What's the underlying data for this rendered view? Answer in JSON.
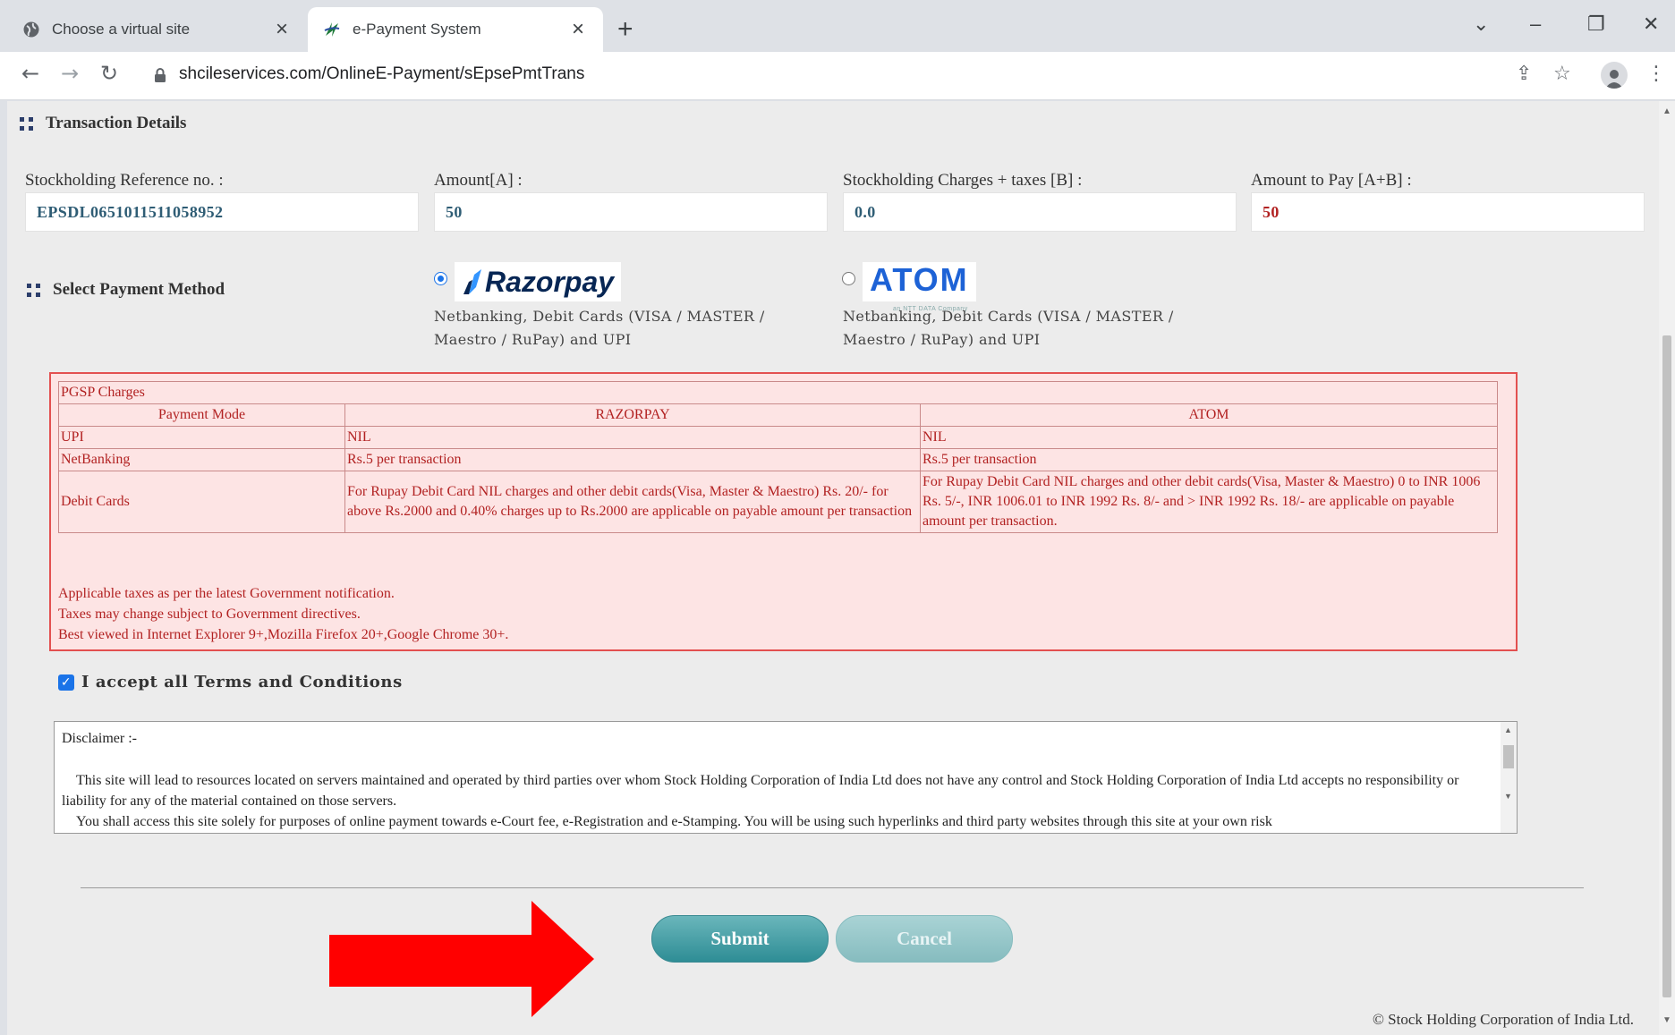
{
  "browser": {
    "tabs": [
      {
        "label": "Choose a virtual site",
        "active": false
      },
      {
        "label": "e-Payment System",
        "active": true
      }
    ],
    "url": "shcileservices.com/OnlineE-Payment/sEpsePmtTrans"
  },
  "transaction": {
    "title": "Transaction Details",
    "fields": [
      {
        "label": "Stockholding Reference no. :",
        "value": "EPSDL0651011511058952"
      },
      {
        "label": "Amount[A] :",
        "value": "50"
      },
      {
        "label": "Stockholding Charges + taxes [B] :",
        "value": "0.0"
      },
      {
        "label": "Amount to Pay [A+B] :",
        "value": "50"
      }
    ]
  },
  "payment": {
    "title": "Select Payment Method",
    "options": [
      {
        "logo": "Razorpay",
        "selected": true,
        "desc_line1": "Netbanking, Debit Cards (VISA / MASTER /",
        "desc_line2": "Maestro / RuPay) and UPI"
      },
      {
        "logo": "ATOM",
        "logo_tagline": "an NTT DATA Company",
        "selected": false,
        "desc_line1": "Netbanking, Debit Cards (VISA / MASTER /",
        "desc_line2": "Maestro / RuPay) and UPI"
      }
    ]
  },
  "pgsp": {
    "caption": "PGSP Charges",
    "headers": [
      "Payment Mode",
      "RAZORPAY",
      "ATOM"
    ],
    "rows": [
      [
        "UPI",
        "NIL",
        "NIL"
      ],
      [
        "NetBanking",
        "Rs.5 per transaction",
        "Rs.5 per transaction"
      ],
      [
        "Debit Cards",
        "For Rupay Debit Card NIL charges and other debit cards(Visa, Master & Maestro) Rs. 20/- for above Rs.2000 and 0.40% charges up to Rs.2000 are applicable on payable amount per transaction",
        "For Rupay Debit Card NIL charges and other debit cards(Visa, Master & Maestro) 0 to INR 1006 Rs. 5/-, INR 1006.01 to INR 1992 Rs. 8/- and > INR 1992 Rs. 18/- are applicable on payable amount per transaction."
      ]
    ],
    "notes": [
      "Applicable taxes as per the latest Government notification.",
      "Taxes may change subject to Government directives.",
      "Best viewed in Internet Explorer 9+,Mozilla Firefox 20+,Google Chrome 30+."
    ]
  },
  "terms": {
    "label": "I accept all Terms and Conditions",
    "checked": true
  },
  "disclaimer": {
    "title": "Disclaimer :-",
    "para1": "This site  will lead to resources located on servers maintained and operated by third parties over whom Stock Holding Corporation of India Ltd  does not have any control and Stock Holding Corporation of India Ltd  accepts no responsibility or liability for any of the material contained on those servers.",
    "para2": "You shall access this site solely for purposes of online payment towards e-Court fee, e-Registration and e-Stamping. You will be using such hyperlinks and third party websites  through this site at your own risk"
  },
  "buttons": {
    "submit": "Submit",
    "cancel": "Cancel"
  },
  "footer": "© Stock Holding Corporation of India Ltd.",
  "colors": {
    "accent_red": "#b22222",
    "button_teal": "#2e8d95",
    "annotation_arrow": "#ff0000"
  }
}
